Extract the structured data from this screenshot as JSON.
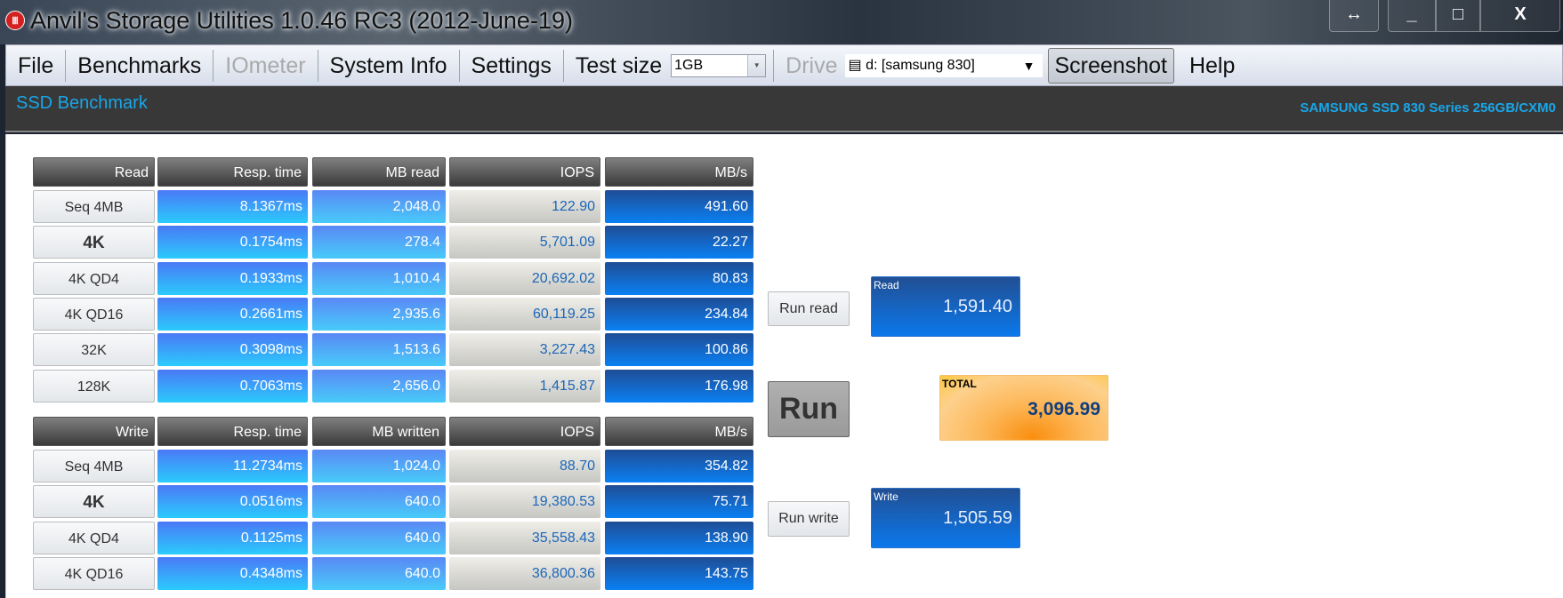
{
  "window": {
    "title": "Anvil's Storage Utilities 1.0.46 RC3 (2012-June-19)",
    "icon": "anvil-app-icon",
    "controls": {
      "resize": "↔",
      "minimize": "_",
      "maximize": "□",
      "close": "X"
    }
  },
  "toolbar": {
    "file": "File",
    "benchmarks": "Benchmarks",
    "iometer": "IOmeter",
    "system_info": "System Info",
    "settings": "Settings",
    "test_size_label": "Test size",
    "test_size_value": "1GB",
    "drive_label": "Drive",
    "drive_value": "d: [samsung 830]",
    "screenshot": "Screenshot",
    "help": "Help"
  },
  "header": {
    "title": "SSD Benchmark",
    "drive_info": "SAMSUNG SSD 830 Series 256GB/CXM0"
  },
  "read_table": {
    "headers": [
      "Read",
      "Resp. time",
      "MB read",
      "IOPS",
      "MB/s"
    ],
    "rows": [
      [
        "Seq 4MB",
        "8.1367ms",
        "2,048.0",
        "122.90",
        "491.60"
      ],
      [
        "4K",
        "0.1754ms",
        "278.4",
        "5,701.09",
        "22.27"
      ],
      [
        "4K QD4",
        "0.1933ms",
        "1,010.4",
        "20,692.02",
        "80.83"
      ],
      [
        "4K QD16",
        "0.2661ms",
        "2,935.6",
        "60,119.25",
        "234.84"
      ],
      [
        "32K",
        "0.3098ms",
        "1,513.6",
        "3,227.43",
        "100.86"
      ],
      [
        "128K",
        "0.7063ms",
        "2,656.0",
        "1,415.87",
        "176.98"
      ]
    ]
  },
  "write_table": {
    "headers": [
      "Write",
      "Resp. time",
      "MB written",
      "IOPS",
      "MB/s"
    ],
    "rows": [
      [
        "Seq 4MB",
        "11.2734ms",
        "1,024.0",
        "88.70",
        "354.82"
      ],
      [
        "4K",
        "0.0516ms",
        "640.0",
        "19,380.53",
        "75.71"
      ],
      [
        "4K QD4",
        "0.1125ms",
        "640.0",
        "35,558.43",
        "138.90"
      ],
      [
        "4K QD16",
        "0.4348ms",
        "640.0",
        "36,800.36",
        "143.75"
      ]
    ]
  },
  "buttons": {
    "run_read": "Run read",
    "run": "Run",
    "run_write": "Run write"
  },
  "results": {
    "read_label": "Read",
    "read_value": "1,591.40",
    "total_label": "TOTAL",
    "total_value": "3,096.99",
    "write_label": "Write",
    "write_value": "1,505.59"
  }
}
